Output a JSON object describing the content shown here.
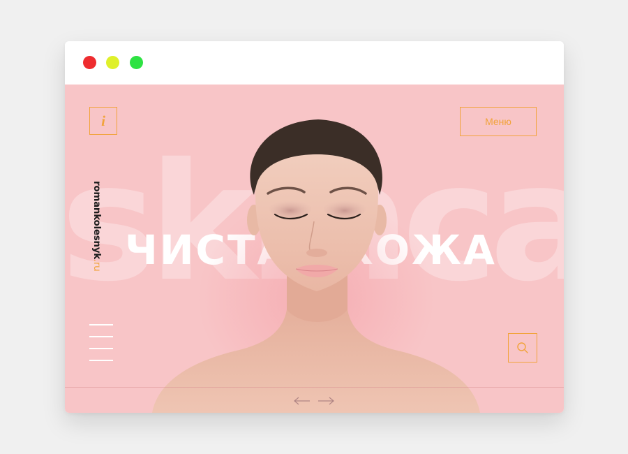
{
  "hero": {
    "background_word": "skincare",
    "title": "ЧИСТАЯ КОЖА",
    "brand_name": "romankolesnyk",
    "brand_tld": ".ru",
    "menu_label": "Меню",
    "info_icon_glyph": "i"
  },
  "icons": {
    "info": "info-icon",
    "search": "search-icon",
    "menu": "hamburger-icon",
    "prev": "arrow-left-icon",
    "next": "arrow-right-icon"
  },
  "colors": {
    "page_background": "#f0f0f0",
    "hero_background": "#f8c5c7",
    "accent": "#f1a33a",
    "close_dot": "#ee2c2f",
    "minimize_dot": "#dff02a",
    "maximize_dot": "#2ee243"
  }
}
